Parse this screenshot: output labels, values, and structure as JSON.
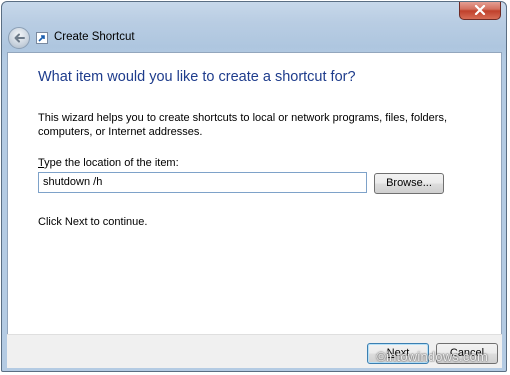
{
  "window": {
    "title": "Create Shortcut"
  },
  "main": {
    "heading": "What item would you like to create a shortcut for?",
    "description": "This wizard helps you to create shortcuts to local or network programs, files, folders, computers, or Internet addresses.",
    "location_label_accel": "T",
    "location_label_rest": "ype the location of the item:",
    "location_value": "shutdown /h",
    "browse_label": "Browse...",
    "continue_text": "Click Next to continue."
  },
  "footer": {
    "next_accel": "N",
    "next_rest": "ext",
    "cancel_label": "Cancel"
  },
  "watermark": "©intowindows.com",
  "icons": {
    "back": "back-arrow-icon",
    "app": "shortcut-icon",
    "close": "close-icon"
  },
  "colors": {
    "heading": "#1e3c8c",
    "close_button": "#c0402b",
    "window_frame": "#b9cde3"
  }
}
